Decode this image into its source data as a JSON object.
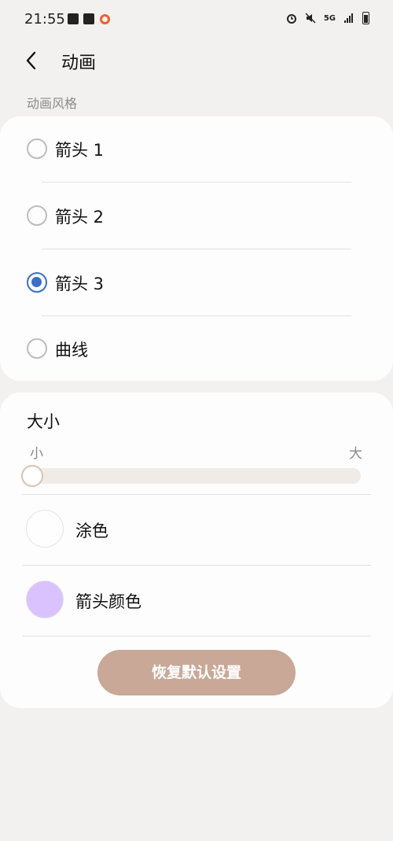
{
  "status_bar": {
    "time": "21:55",
    "network": "5G",
    "left_icons": [
      "message-icon",
      "gallery-icon",
      "app-ring-icon"
    ],
    "right_icons": [
      "alarm-icon",
      "mute-icon",
      "signal-icon",
      "battery-icon"
    ],
    "accent_ring_color": "#e8632c"
  },
  "header": {
    "title": "动画",
    "back_icon": "chevron-left-icon"
  },
  "animation_style": {
    "section_label": "动画风格",
    "options": [
      {
        "label": "箭头 1",
        "selected": false
      },
      {
        "label": "箭头 2",
        "selected": false
      },
      {
        "label": "箭头 3",
        "selected": true
      },
      {
        "label": "曲线",
        "selected": false
      }
    ],
    "selected_color": "#3b6fc7"
  },
  "size": {
    "title": "大小",
    "min_label": "小",
    "max_label": "大",
    "value_fraction": 0.0
  },
  "colors": {
    "fill_label": "涂色",
    "fill_color": "#fefefe",
    "arrow_color_label": "箭头颜色",
    "arrow_color": "#d9c2ff"
  },
  "reset_button": {
    "label": "恢复默认设置",
    "color": "#c9a898"
  }
}
